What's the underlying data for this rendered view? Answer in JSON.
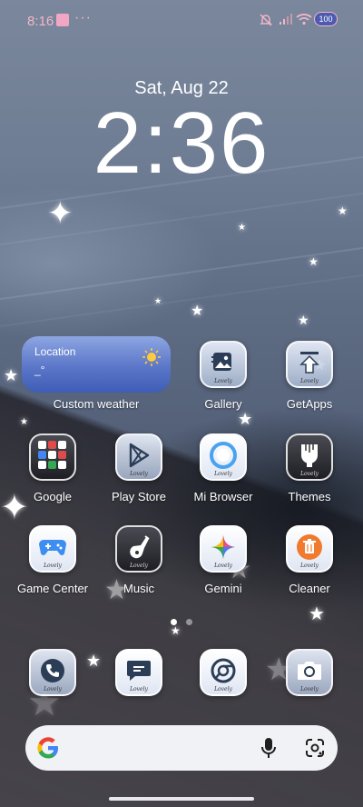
{
  "status_bar": {
    "time": "8:16",
    "more": "···",
    "battery": "100",
    "icons": [
      "mute-bell-icon",
      "signal-icon",
      "wifi-icon",
      "battery-icon"
    ]
  },
  "lock": {
    "date": "Sat, Aug 22",
    "time": "2:36"
  },
  "weather_widget": {
    "location": "Location",
    "temp": "_°",
    "label": "Custom weather",
    "color": "#4d6bc2"
  },
  "apps": {
    "gallery": "Gallery",
    "getapps": "GetApps",
    "google": "Google",
    "playstore": "Play Store",
    "mibrowser": "Mi Browser",
    "themes": "Themes",
    "gamecenter": "Game Center",
    "music": "Music",
    "gemini": "Gemini",
    "cleaner": "Cleaner"
  },
  "dock": [
    "phone-icon",
    "messages-icon",
    "chrome-icon",
    "camera-icon"
  ],
  "icon_badge": "Lovely",
  "page_indicator": {
    "current": 1,
    "total": 2
  }
}
